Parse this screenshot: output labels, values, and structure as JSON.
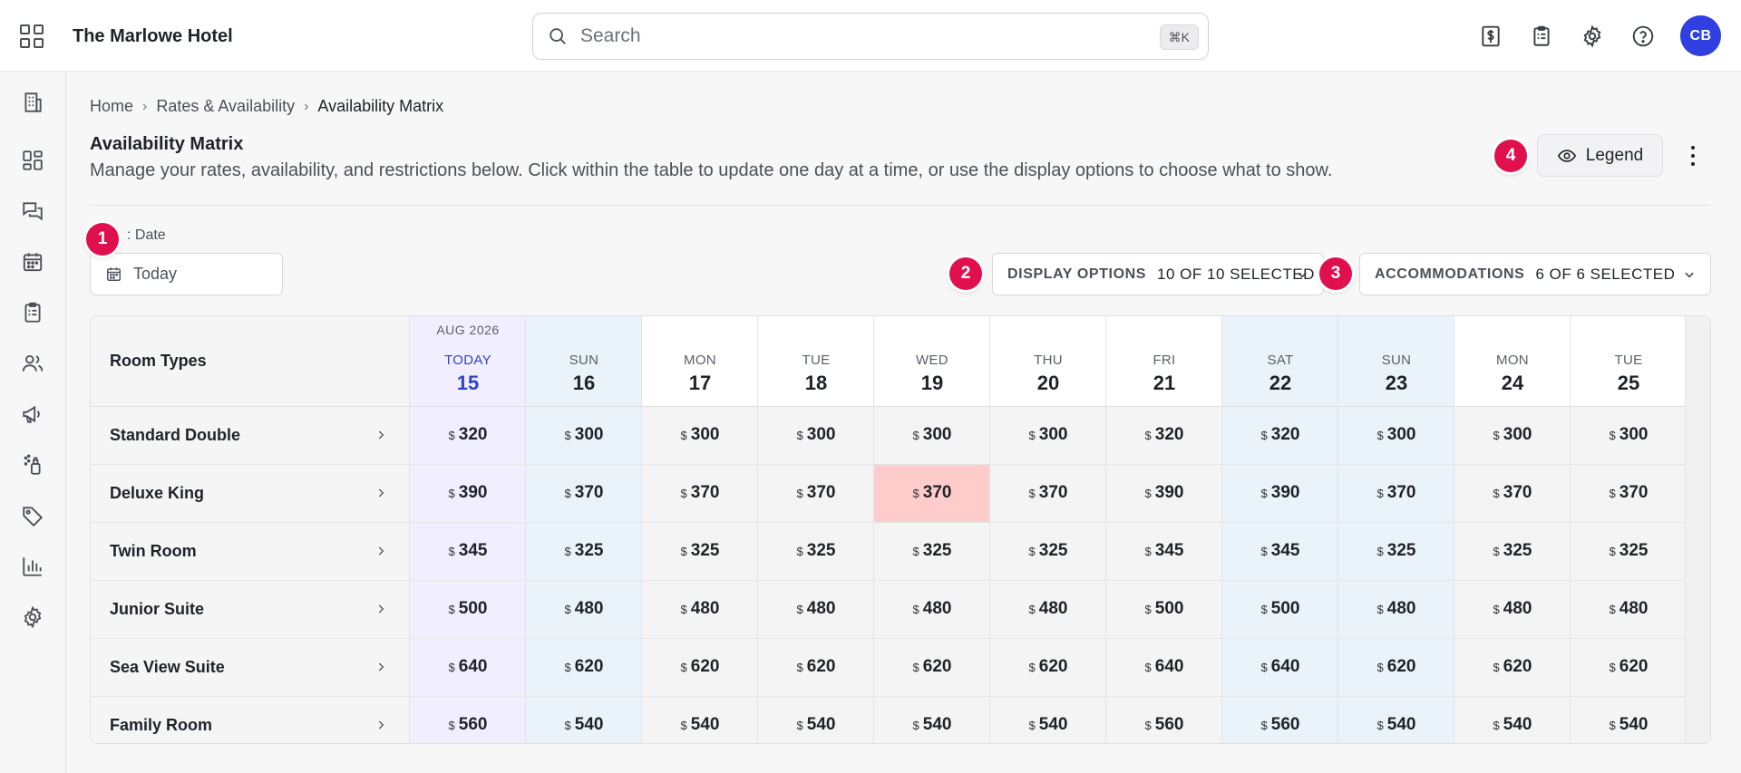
{
  "app": {
    "hotel_name": "The Marlowe Hotel",
    "search_placeholder": "Search",
    "search_shortcut": "⌘K",
    "avatar_initials": "CB",
    "colors": {
      "accent": "#2f3fe0",
      "badge": "#e0104f",
      "highlight_cell": "#ffcccc"
    }
  },
  "top_icons": [
    "billing-icon",
    "clipboard-icon",
    "settings-icon",
    "help-icon"
  ],
  "sidebar": [
    "building-icon",
    "dashboard-icon",
    "messages-icon",
    "calendar-icon",
    "clipboard-icon",
    "guests-icon",
    "megaphone-icon",
    "cleaning-icon",
    "tag-icon",
    "chart-icon",
    "settings-icon"
  ],
  "breadcrumb": {
    "home": "Home",
    "section": "Rates & Availability",
    "current": "Availability Matrix"
  },
  "page": {
    "title": "Availability Matrix",
    "description": "Manage your rates, availability, and restrictions below. Click within the table to update one day at a time, or use the display options to choose what to show.",
    "legend_label": "Legend"
  },
  "badges": {
    "b1": "1",
    "b2": "2",
    "b3": "3",
    "b4": "4"
  },
  "filters": {
    "date_label": ": Date",
    "date_value": "Today",
    "display_options_label": "DISPLAY OPTIONS",
    "display_options_value": "10 OF 10 SELECTED",
    "accommodations_label": "ACCOMMODATIONS",
    "accommodations_value": "6 OF 6 SELECTED"
  },
  "table": {
    "room_types_header": "Room Types",
    "month_label": "AUG 2026",
    "currency": "$",
    "days": [
      {
        "dow": "TODAY",
        "num": "15",
        "kind": "today"
      },
      {
        "dow": "SUN",
        "num": "16",
        "kind": "weekend"
      },
      {
        "dow": "MON",
        "num": "17",
        "kind": "weekday"
      },
      {
        "dow": "TUE",
        "num": "18",
        "kind": "weekday"
      },
      {
        "dow": "WED",
        "num": "19",
        "kind": "weekday"
      },
      {
        "dow": "THU",
        "num": "20",
        "kind": "weekday"
      },
      {
        "dow": "FRI",
        "num": "21",
        "kind": "weekday"
      },
      {
        "dow": "SAT",
        "num": "22",
        "kind": "weekend"
      },
      {
        "dow": "SUN",
        "num": "23",
        "kind": "weekend"
      },
      {
        "dow": "MON",
        "num": "24",
        "kind": "weekday"
      },
      {
        "dow": "TUE",
        "num": "25",
        "kind": "weekday"
      }
    ],
    "rows": [
      {
        "name": "Standard Double",
        "rates": [
          "320",
          "300",
          "300",
          "300",
          "300",
          "300",
          "320",
          "320",
          "300",
          "300",
          "300"
        ]
      },
      {
        "name": "Deluxe King",
        "rates": [
          "390",
          "370",
          "370",
          "370",
          "370",
          "370",
          "390",
          "390",
          "370",
          "370",
          "370"
        ],
        "highlight": [
          4
        ]
      },
      {
        "name": "Twin Room",
        "rates": [
          "345",
          "325",
          "325",
          "325",
          "325",
          "325",
          "345",
          "345",
          "325",
          "325",
          "325"
        ]
      },
      {
        "name": "Junior Suite",
        "rates": [
          "500",
          "480",
          "480",
          "480",
          "480",
          "480",
          "500",
          "500",
          "480",
          "480",
          "480"
        ]
      },
      {
        "name": "Sea View Suite",
        "rates": [
          "640",
          "620",
          "620",
          "620",
          "620",
          "620",
          "640",
          "640",
          "620",
          "620",
          "620"
        ]
      },
      {
        "name": "Family Room",
        "rates": [
          "560",
          "540",
          "540",
          "540",
          "540",
          "540",
          "560",
          "560",
          "540",
          "540",
          "540"
        ]
      }
    ]
  }
}
